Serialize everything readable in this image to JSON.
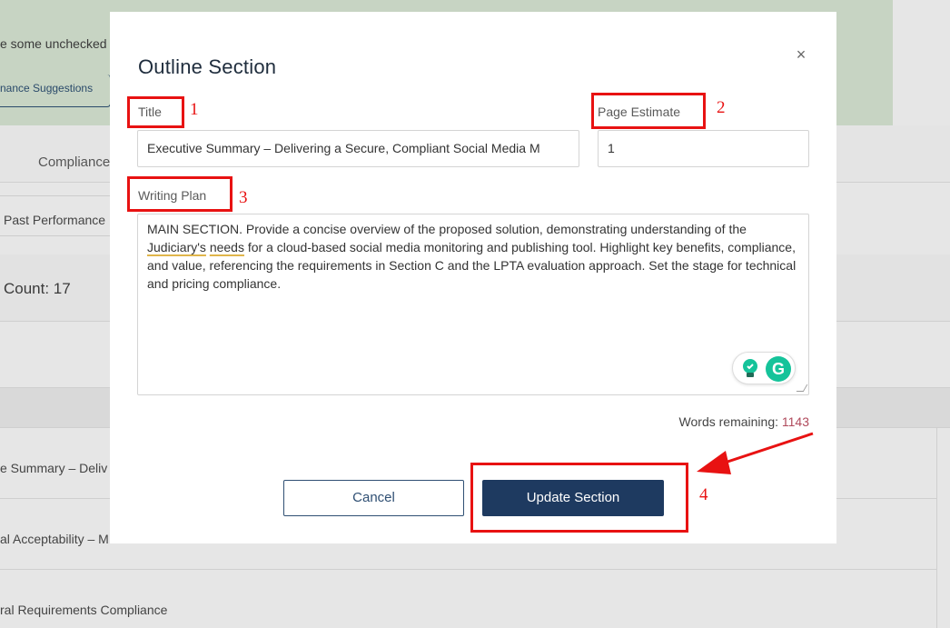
{
  "background": {
    "banner_text": "e some unchecked",
    "banner_link": "nance Suggestions",
    "tab_label": "Compliance",
    "chip_label": "Past Performance",
    "count_label": "Count: 17",
    "items": [
      "e Summary – Deliv",
      "al Acceptability – M",
      "ral Requirements Compliance"
    ]
  },
  "modal": {
    "title": "Outline Section",
    "close_symbol": "×",
    "fields": {
      "title_label": "Title",
      "title_value": "Executive Summary – Delivering a Secure, Compliant Social Media M",
      "page_estimate_label": "Page Estimate",
      "page_estimate_value": "1",
      "writing_plan_label": "Writing Plan",
      "writing_plan": {
        "part1": "MAIN SECTION. Provide a concise overview of the proposed solution, demonstrating understanding of the ",
        "underlined1": "Judiciary's",
        "space": " ",
        "underlined2": "needs",
        "part2": " for a cloud-based social media monitoring and publishing tool. Highlight key benefits, compliance, and value, referencing the requirements in Section C and the LPTA evaluation approach. Set the stage for technical and pricing compliance."
      }
    },
    "grammar_widget": {
      "bulb_icon": "lightbulb-icon",
      "g_letter": "G"
    },
    "words_remaining_label": "Words remaining:",
    "words_remaining_value": "1143",
    "cancel_label": "Cancel",
    "update_label": "Update Section"
  },
  "annotations": [
    "1",
    "2",
    "3",
    "4"
  ],
  "colors": {
    "primary": "#1e3a60",
    "annotation_red": "#e81212",
    "banner_green": "#c7d4c3",
    "grammarly_green": "#15c39a",
    "words_count": "#b04a5c"
  }
}
